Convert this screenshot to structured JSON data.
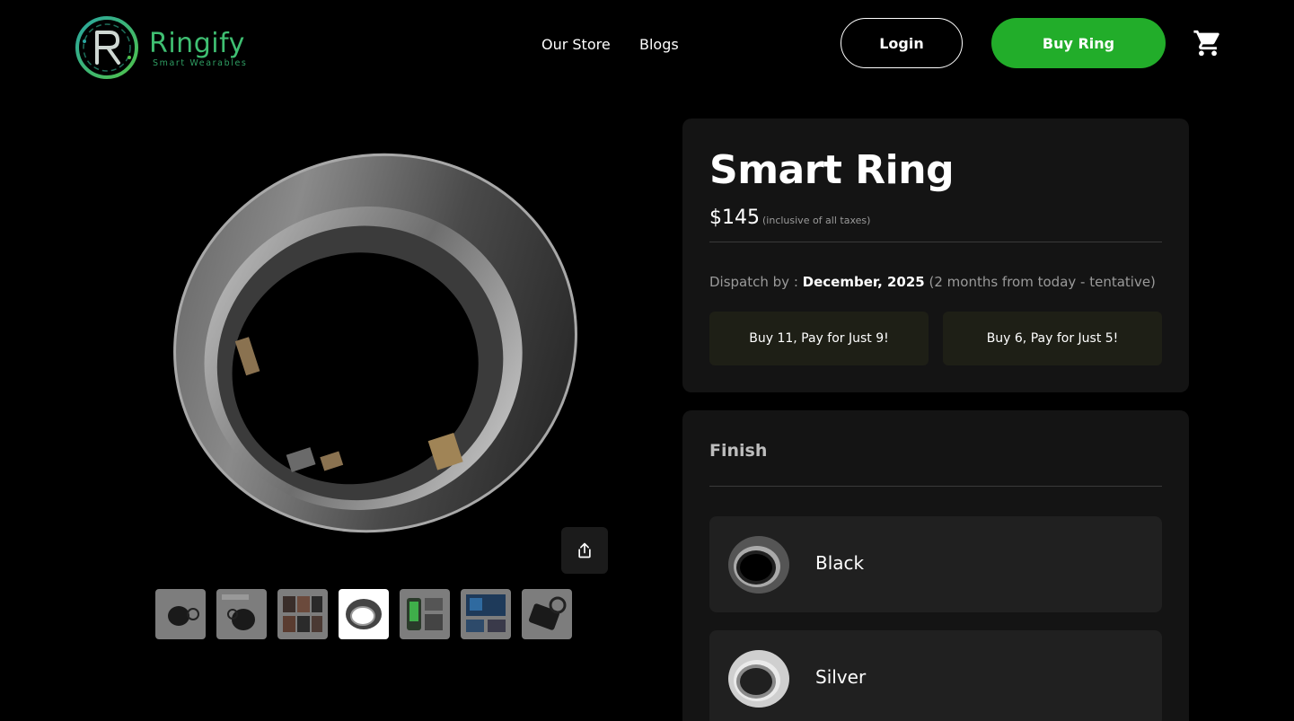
{
  "header": {
    "brand_name": "Ringify",
    "brand_tagline": "Smart Wearables",
    "nav": [
      {
        "label": "Our Store"
      },
      {
        "label": "Blogs"
      }
    ],
    "login_label": "Login",
    "buy_label": "Buy Ring",
    "cart_icon": "cart-icon",
    "accent_color": "#22ad2a"
  },
  "gallery": {
    "share_icon": "share-icon",
    "thumbnail_count": 7,
    "active_thumbnail": 4
  },
  "product": {
    "title": "Smart Ring",
    "price": "$145",
    "tax_note": "(inclusive of all taxes)",
    "dispatch_label": "Dispatch by : ",
    "dispatch_date": "December, 2025",
    "dispatch_note": " (2 months from today - tentative)",
    "offers": [
      {
        "label": "Buy 11, Pay for Just 9!"
      },
      {
        "label": "Buy 6, Pay for Just 5!"
      }
    ]
  },
  "finish": {
    "title": "Finish",
    "options": [
      {
        "label": "Black"
      },
      {
        "label": "Silver"
      }
    ]
  }
}
